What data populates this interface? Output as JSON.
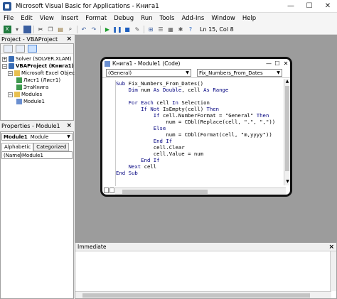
{
  "window": {
    "title": "Microsoft Visual Basic for Applications - Книга1",
    "minimize": "—",
    "maximize": "☐",
    "close": "✕"
  },
  "menu": [
    "File",
    "Edit",
    "View",
    "Insert",
    "Format",
    "Debug",
    "Run",
    "Tools",
    "Add-Ins",
    "Window",
    "Help"
  ],
  "toolbar": {
    "status": "Ln 15, Col 8"
  },
  "project": {
    "title": "Project - VBAProject",
    "close": "×",
    "tree": [
      {
        "label": "Solver (SOLVER.XLAM)",
        "exp": "+"
      },
      {
        "label": "VBAProject (Книга1)",
        "exp": "−"
      },
      {
        "label": "Microsoft Excel Objects",
        "exp": "−"
      },
      {
        "label": "Лист1 (Лист1)"
      },
      {
        "label": "ЭтаКнига"
      },
      {
        "label": "Modules",
        "exp": "−"
      },
      {
        "label": "Module1"
      }
    ]
  },
  "properties": {
    "title": "Properties - Module1",
    "close": "×",
    "object_name": "Module1",
    "object_type": "Module",
    "tabs": [
      "Alphabetic",
      "Categorized"
    ],
    "prop_key": "(Name)",
    "prop_value": "Module1"
  },
  "code_window": {
    "title": "Книга1 - Module1 (Code)",
    "object_combo": "(General)",
    "proc_combo": "Fix_Numbers_From_Dates",
    "lines": [
      "Sub Fix_Numbers_From_Dates()",
      "    Dim num As Double, cell As Range",
      "",
      "    For Each cell In Selection",
      "        If Not IsEmpty(cell) Then",
      "            If cell.NumberFormat = \"General\" Then",
      "                num = CDbl(Replace(cell, \".\", \",\"))",
      "            Else",
      "                num = CDbl(Format(cell, \"m,yyyy\"))",
      "            End If",
      "            cell.Clear",
      "            cell.Value = num",
      "        End If",
      "    Next cell",
      "End Sub"
    ]
  },
  "immediate": {
    "title": "Immediate",
    "close": "×"
  }
}
